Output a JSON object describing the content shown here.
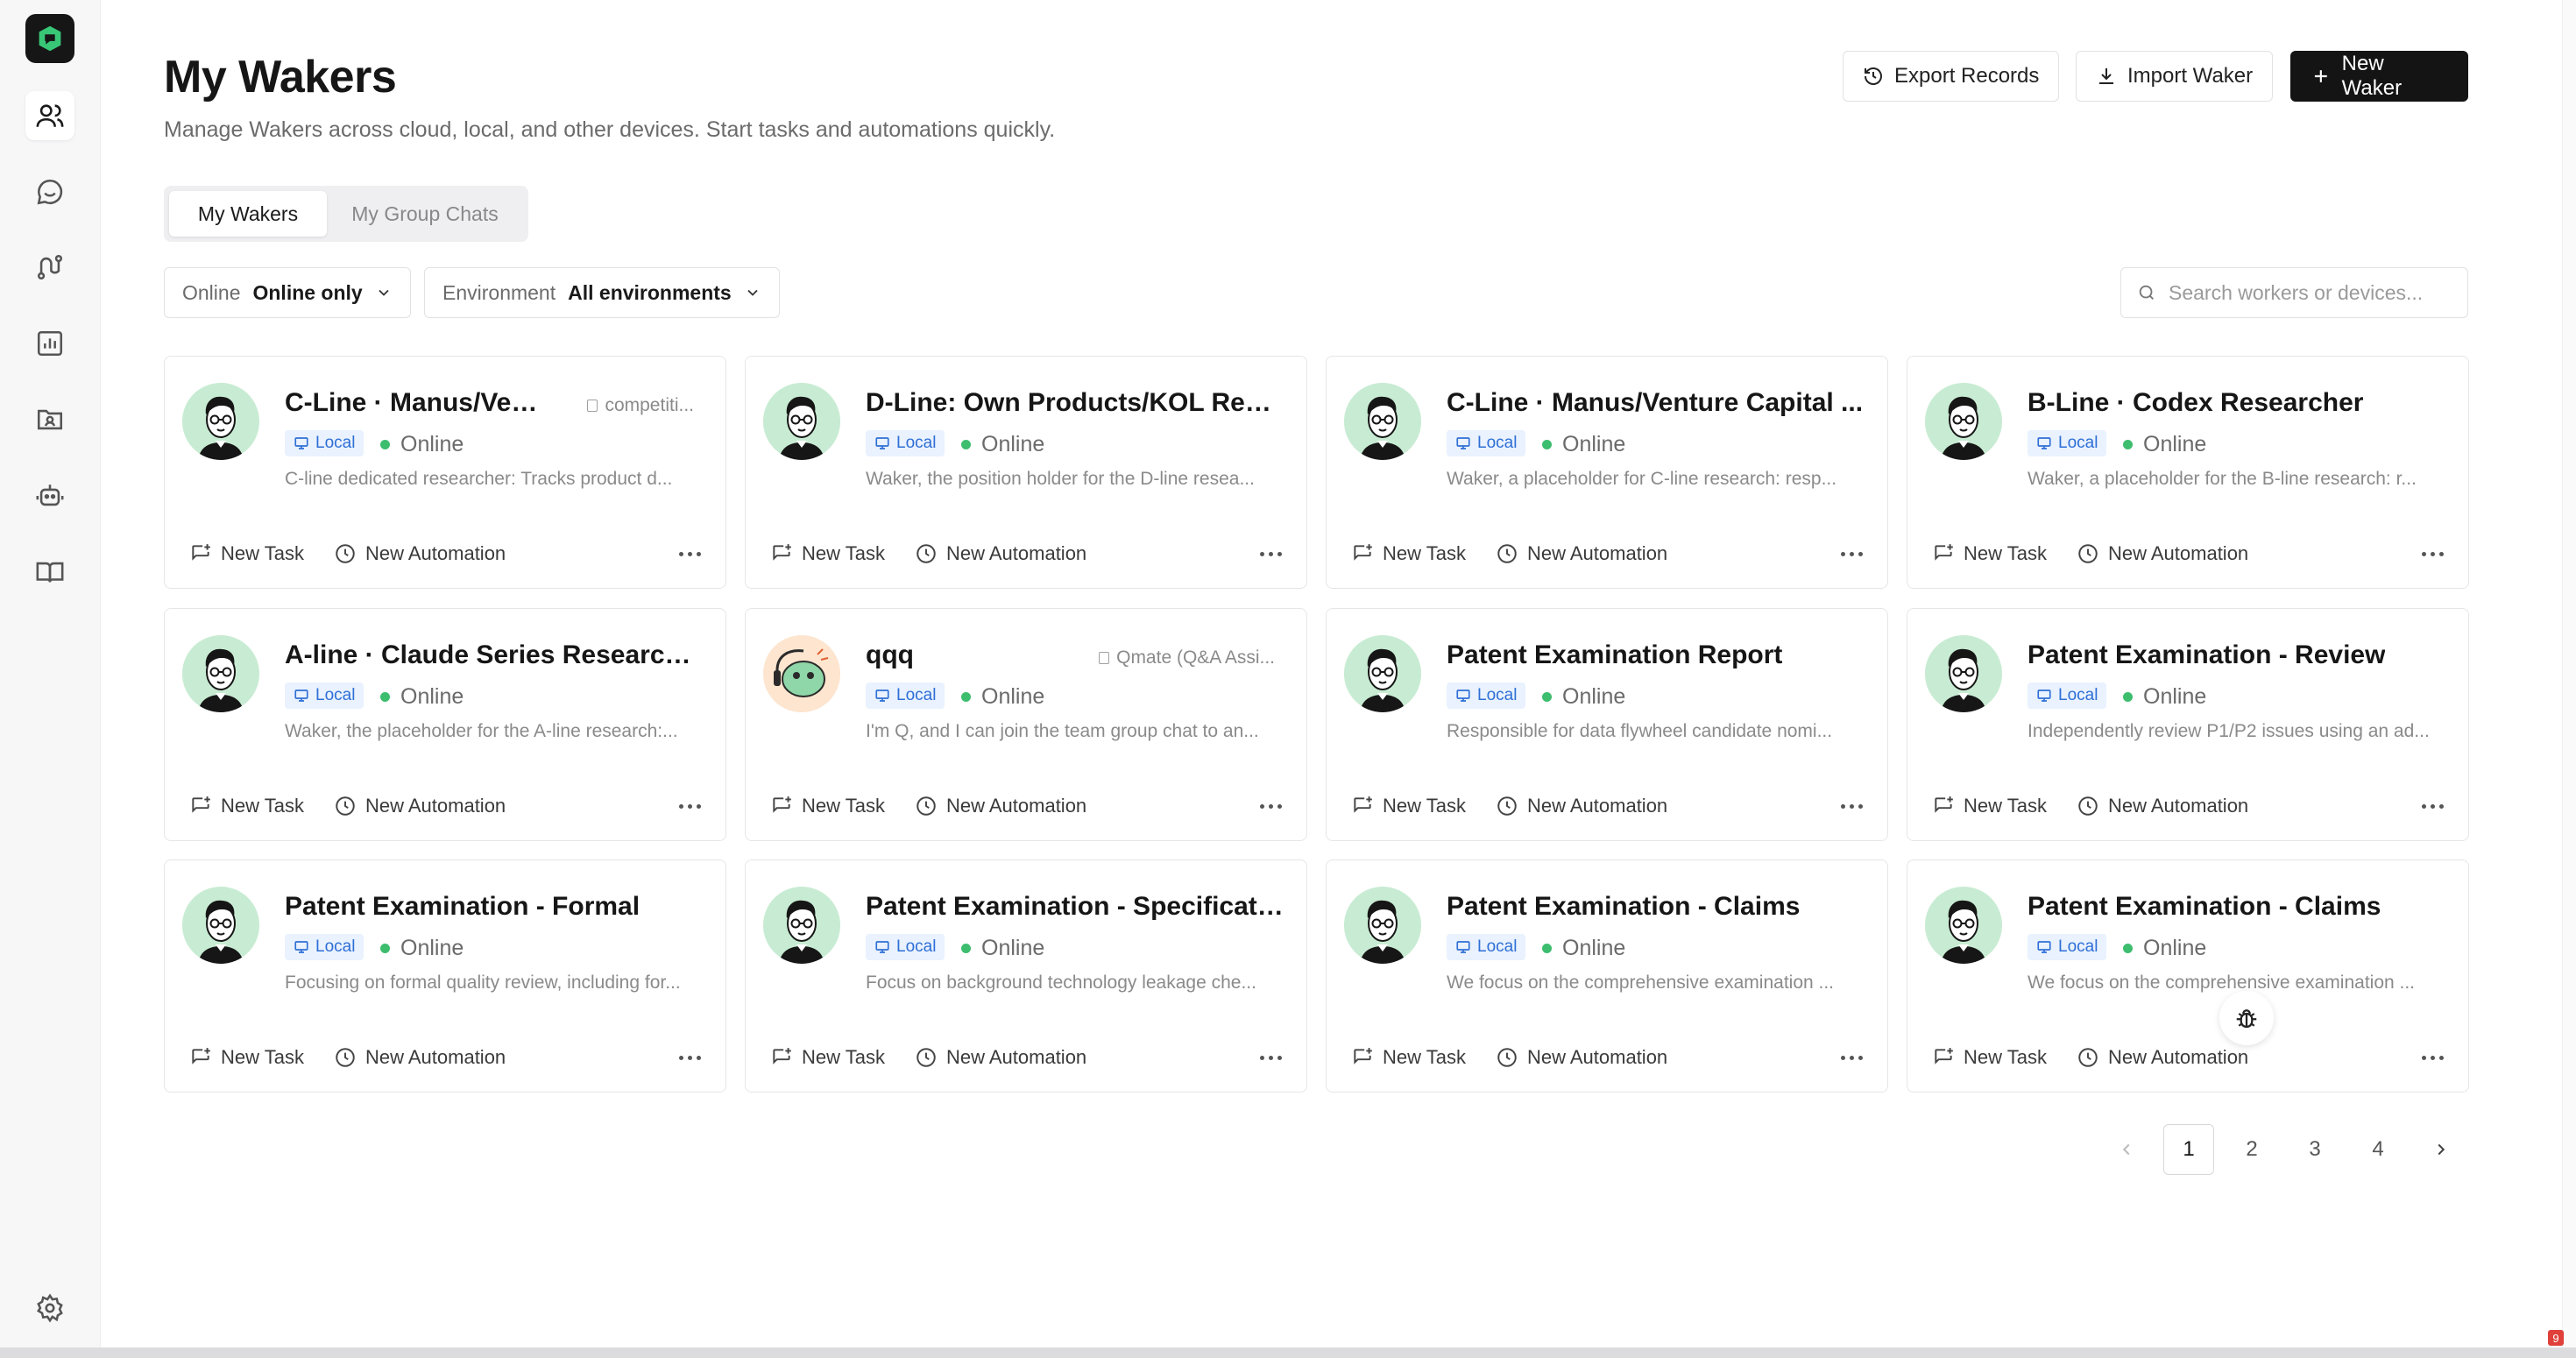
{
  "sidebar": {
    "items": [
      {
        "name": "users",
        "icon": "users-icon"
      },
      {
        "name": "chats",
        "icon": "chat-bubble-icon"
      },
      {
        "name": "workflow",
        "icon": "workflow-icon"
      },
      {
        "name": "analytics",
        "icon": "bar-chart-icon"
      },
      {
        "name": "contacts",
        "icon": "contact-folder-icon"
      },
      {
        "name": "bots",
        "icon": "robot-icon"
      },
      {
        "name": "docs",
        "icon": "book-icon"
      }
    ],
    "settings_icon": "gear-icon"
  },
  "header": {
    "title": "My Wakers",
    "subtitle": "Manage Wakers across cloud, local, and other devices. Start tasks and automations quickly.",
    "export_label": "Export Records",
    "import_label": "Import Waker",
    "new_label": "New Waker"
  },
  "tabs": [
    {
      "label": "My Wakers",
      "active": true
    },
    {
      "label": "My Group Chats",
      "active": false
    }
  ],
  "filters": {
    "online_label": "Online",
    "online_value": "Online only",
    "env_label": "Environment",
    "env_value": "All environments"
  },
  "search": {
    "placeholder": "Search workers or devices..."
  },
  "card_common": {
    "local_label": "Local",
    "status_label": "Online",
    "new_task_label": "New Task",
    "new_automation_label": "New Automation"
  },
  "cards": [
    {
      "name": "C-Line · Manus/Ven...",
      "tag": "competiti...",
      "desc": "C-line dedicated researcher: Tracks product d...",
      "avatar": "person"
    },
    {
      "name": "D-Line: Own Products/KOL Rese...",
      "tag": "",
      "desc": "Waker, the position holder for the D-line resea...",
      "avatar": "person"
    },
    {
      "name": "C-Line · Manus/Venture Capital ...",
      "tag": "",
      "desc": "Waker, a placeholder for C-line research: resp...",
      "avatar": "person"
    },
    {
      "name": "B-Line · Codex Researcher",
      "tag": "",
      "desc": "Waker, a placeholder for the B-line research: r...",
      "avatar": "person"
    },
    {
      "name": "A-line · Claude Series Researcher",
      "tag": "",
      "desc": "Waker, the placeholder for the A-line research:...",
      "avatar": "person"
    },
    {
      "name": "qqq",
      "tag": "Qmate (Q&A Assi...",
      "desc": "I'm Q, and I can join the team group chat to an...",
      "avatar": "robot"
    },
    {
      "name": "Patent Examination Report",
      "tag": "",
      "desc": "Responsible for data flywheel candidate nomi...",
      "avatar": "person"
    },
    {
      "name": "Patent Examination - Review",
      "tag": "",
      "desc": "Independently review P1/P2 issues using an ad...",
      "avatar": "person"
    },
    {
      "name": "Patent Examination - Formal",
      "tag": "",
      "desc": "Focusing on formal quality review, including for...",
      "avatar": "person"
    },
    {
      "name": "Patent Examination - Specificati...",
      "tag": "",
      "desc": "Focus on background technology leakage che...",
      "avatar": "person"
    },
    {
      "name": "Patent Examination - Claims",
      "tag": "",
      "desc": "We focus on the comprehensive examination ...",
      "avatar": "person"
    },
    {
      "name": "Patent Examination - Claims",
      "tag": "",
      "desc": "We focus on the comprehensive examination ...",
      "avatar": "person"
    }
  ],
  "pagination": {
    "pages": [
      "1",
      "2",
      "3",
      "4"
    ],
    "current": "1"
  },
  "corner_badge": "9",
  "colors": {
    "accent_dark": "#141414",
    "online_dot": "#3dbd6e",
    "local_badge_bg": "#e9f2fe",
    "local_badge_text": "#2f6fd6",
    "logo_green": "#38c777"
  }
}
